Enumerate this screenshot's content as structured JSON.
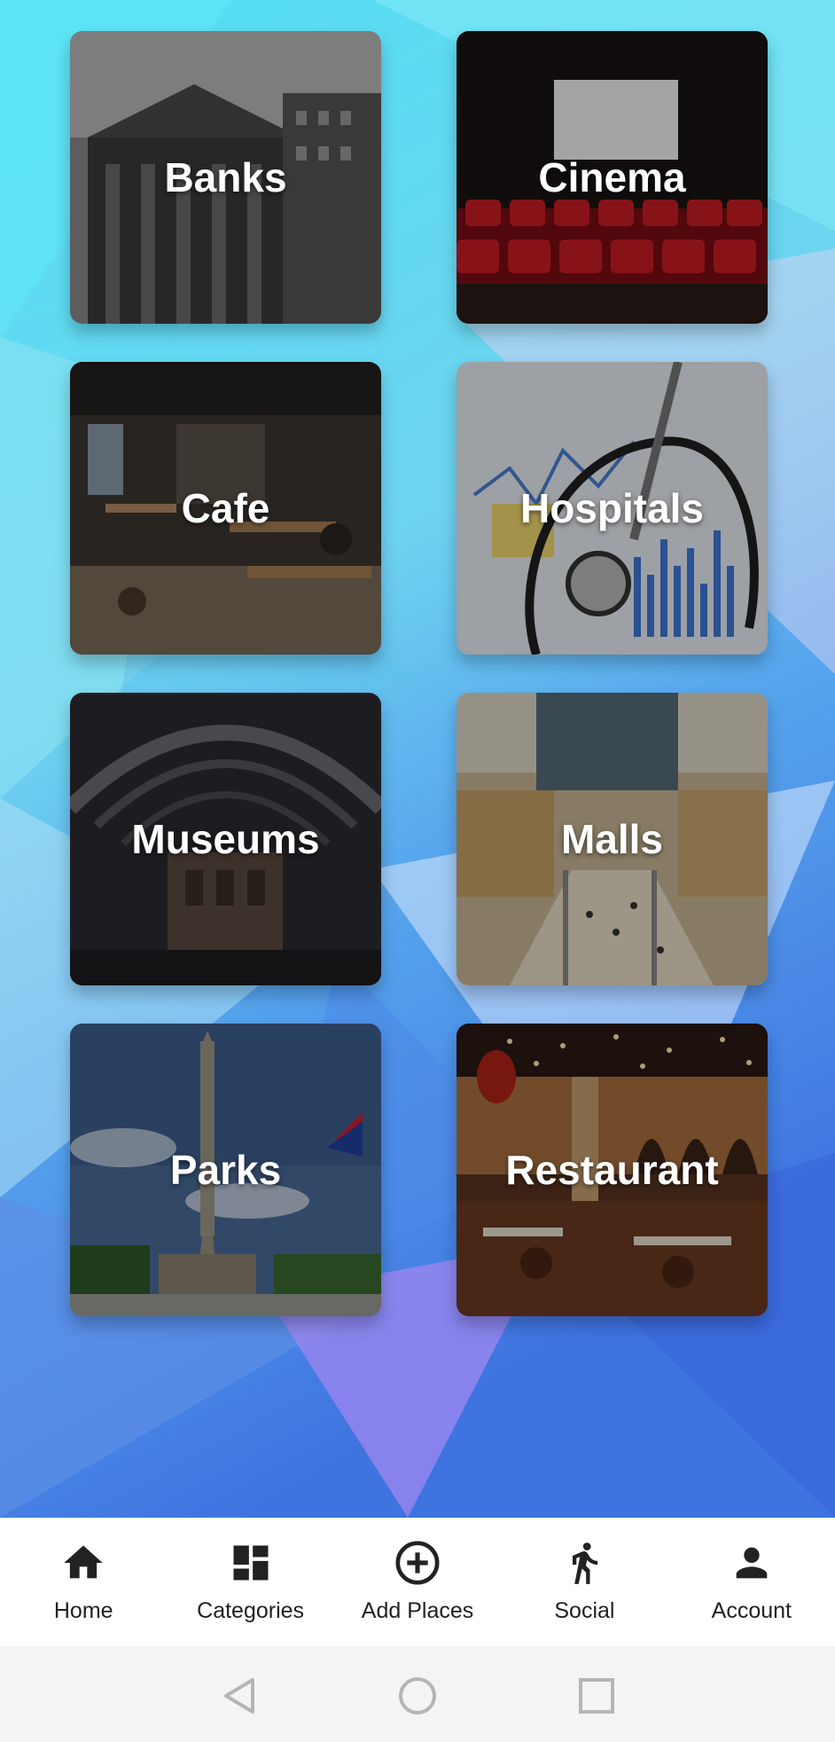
{
  "colors": {
    "background_start": "#49c8f0",
    "background_end": "#3f73e0",
    "nav_icon": "#222222",
    "nav_label": "#222222",
    "system_nav_icon": "#b5b5b5"
  },
  "categories": [
    {
      "label": "Banks",
      "icon": "bank-photo"
    },
    {
      "label": "Cinema",
      "icon": "cinema-photo"
    },
    {
      "label": "Cafe",
      "icon": "cafe-photo"
    },
    {
      "label": "Hospitals",
      "icon": "stethoscope-photo"
    },
    {
      "label": "Museums",
      "icon": "museum-photo"
    },
    {
      "label": "Malls",
      "icon": "mall-photo"
    },
    {
      "label": "Parks",
      "icon": "monument-photo"
    },
    {
      "label": "Restaurant",
      "icon": "restaurant-photo"
    }
  ],
  "bottom_nav": {
    "items": [
      {
        "label": "Home",
        "icon": "home-icon"
      },
      {
        "label": "Categories",
        "icon": "dashboard-icon"
      },
      {
        "label": "Add Places",
        "icon": "add-circle-icon"
      },
      {
        "label": "Social",
        "icon": "walking-person-icon"
      },
      {
        "label": "Account",
        "icon": "person-icon"
      }
    ]
  },
  "system_nav": {
    "buttons": [
      "back-icon",
      "home-circle-icon",
      "recents-square-icon"
    ]
  }
}
